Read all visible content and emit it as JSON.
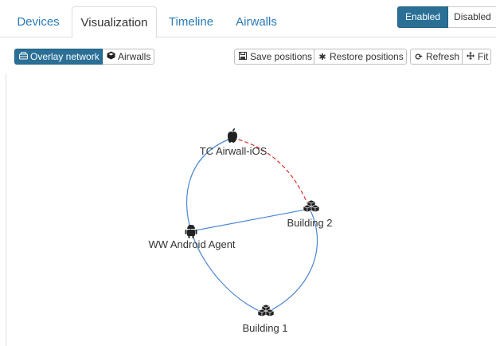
{
  "tabs": [
    {
      "label": "Devices",
      "active": false
    },
    {
      "label": "Visualization",
      "active": true
    },
    {
      "label": "Timeline",
      "active": false
    },
    {
      "label": "Airwalls",
      "active": false
    }
  ],
  "state_toggle": {
    "enabled_label": "Enabled",
    "disabled_label": "Disabled",
    "selected": "Enabled"
  },
  "view_toggle": {
    "overlay_label": "Overlay network",
    "overlay_icon": "network-icon",
    "airwalls_label": "Airwalls",
    "airwalls_icon": "airwall-icon",
    "selected": "Overlay network"
  },
  "toolbar": {
    "save_label": "Save positions",
    "save_icon": "save-icon",
    "restore_label": "Restore positions",
    "restore_icon": "asterisk-icon",
    "refresh_label": "Refresh",
    "refresh_icon": "refresh-icon",
    "fit_label": "Fit",
    "fit_icon": "move-icon"
  },
  "graph": {
    "nodes": [
      {
        "id": "ios",
        "label": "TC Airwall-iOS",
        "icon": "apple-icon"
      },
      {
        "id": "b2",
        "label": "Building 2",
        "icon": "building-cluster-icon"
      },
      {
        "id": "android",
        "label": "WW Android Agent",
        "icon": "android-icon"
      },
      {
        "id": "b1",
        "label": "Building 1",
        "icon": "building-cluster-icon"
      }
    ],
    "edges": [
      {
        "from": "ios",
        "to": "android",
        "style": "solid",
        "color": "#4a86d4"
      },
      {
        "from": "ios",
        "to": "b2",
        "style": "dashed",
        "color": "#e03030"
      },
      {
        "from": "android",
        "to": "b2",
        "style": "solid",
        "color": "#4a86d4"
      },
      {
        "from": "android",
        "to": "b1",
        "style": "solid",
        "color": "#4a86d4"
      },
      {
        "from": "b2",
        "to": "b1",
        "style": "solid",
        "color": "#4a86d4"
      }
    ]
  },
  "colors": {
    "accent": "#2a6f96",
    "link": "#2a7bb8",
    "edge": "#4a86d4",
    "edge_alert": "#e03030"
  }
}
